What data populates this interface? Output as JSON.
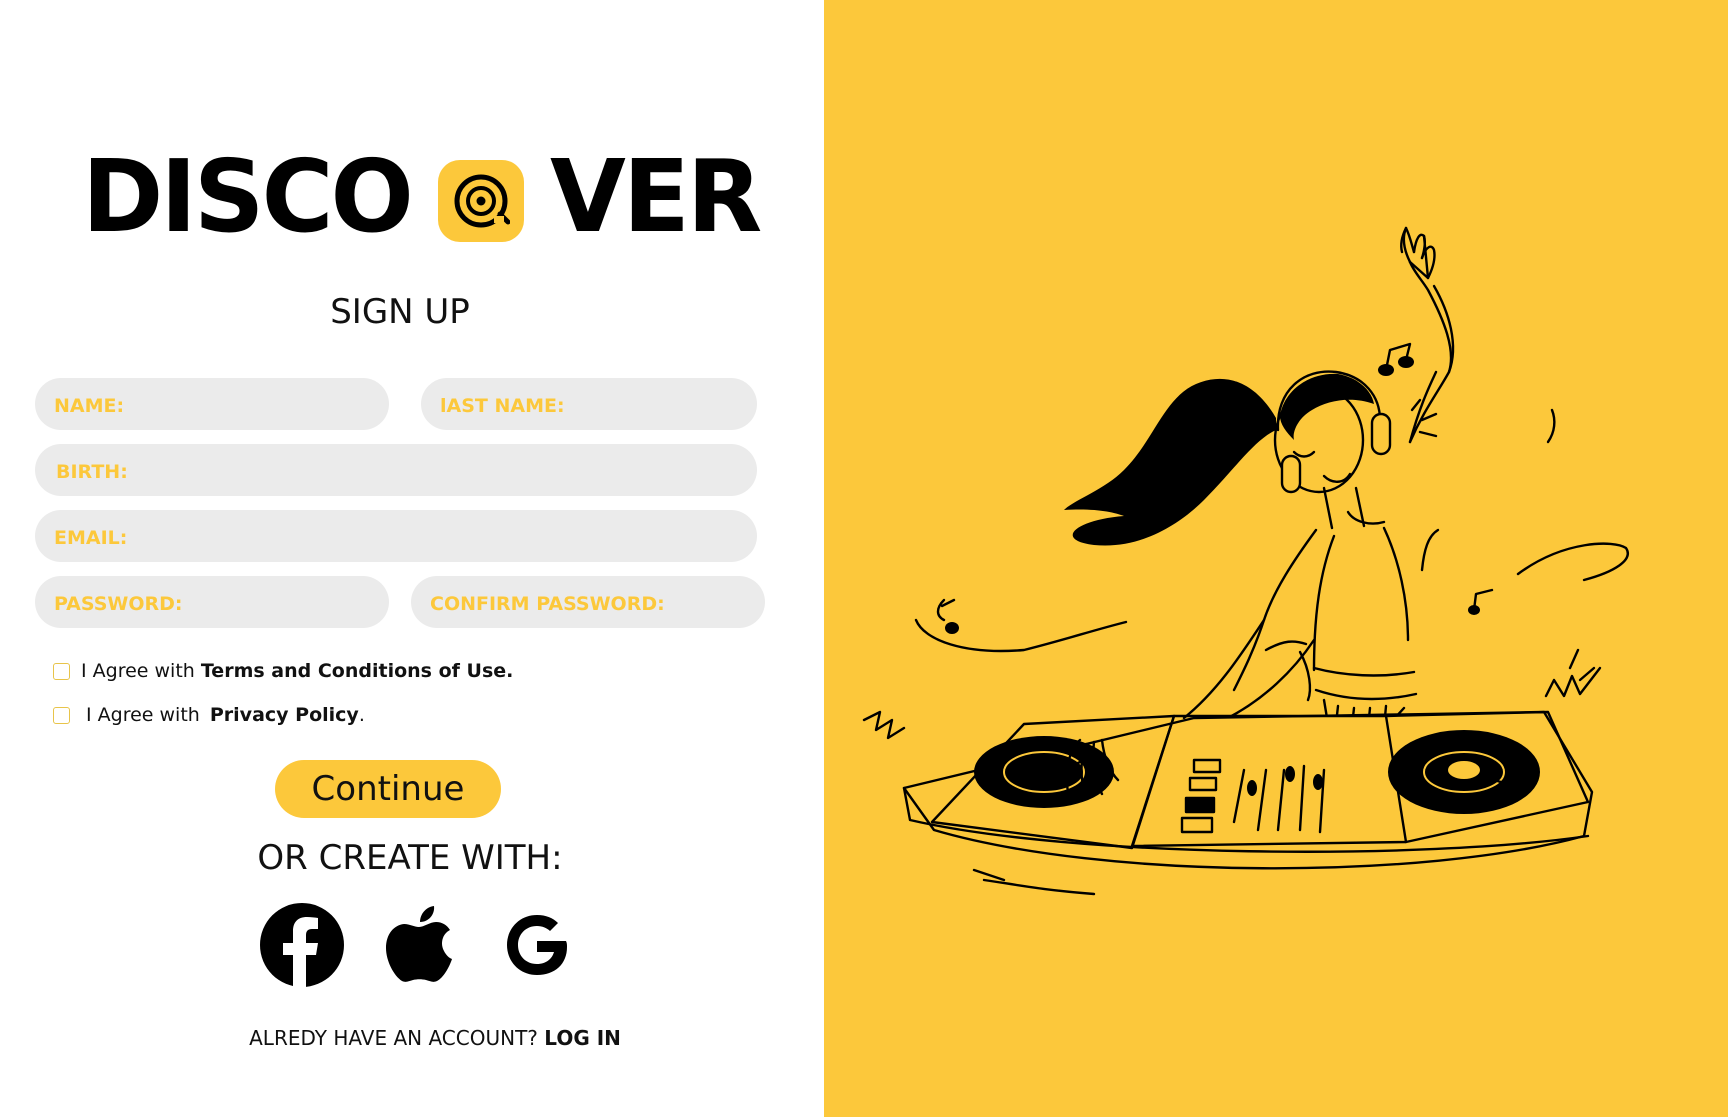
{
  "brand": {
    "part1": "DISCO",
    "part2": "VER"
  },
  "page_title": "SIGN UP",
  "form": {
    "name_placeholder": "NAME:",
    "last_name_placeholder": "lAST NAME:",
    "birth_placeholder": "BIRTH:",
    "email_placeholder": "EMAIL:",
    "password_placeholder": "PASSWORD:",
    "confirm_password_placeholder": "CONFIRM PASSWORD:"
  },
  "agreements": {
    "terms_prefix": "I Agree with ",
    "terms_link": "Terms and Conditions of Use",
    "terms_suffix": ".",
    "privacy_prefix": "I Agree with ",
    "privacy_link": "Privacy Policy",
    "privacy_suffix": "."
  },
  "continue_label": "Continue",
  "or_create_label": "OR CREATE WITH:",
  "social": [
    "facebook-icon",
    "apple-icon",
    "google-icon"
  ],
  "login": {
    "prompt": "ALREDY HAVE AN ACCOUNT? ",
    "link": "LOG IN"
  },
  "colors": {
    "accent": "#fcc83b",
    "field_bg": "#ebebeb",
    "text": "#111111"
  }
}
